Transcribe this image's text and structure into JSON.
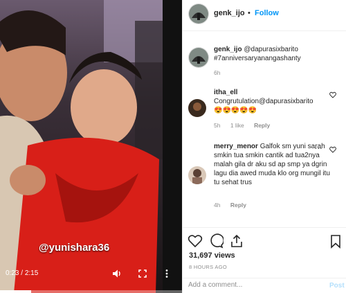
{
  "video": {
    "overlay_text": "@yunishara36",
    "current_time": "0:23",
    "separator": "/",
    "duration": "2:15",
    "progress": 0.17,
    "icons": [
      "volume-icon",
      "fullscreen-icon",
      "more-vertical-icon"
    ]
  },
  "post_header": {
    "username": "genk_ijo",
    "separator": "•",
    "follow_label": "Follow"
  },
  "caption": {
    "username": "genk_ijo",
    "text": "@dapurasixbarito #7anniversaryanangashanty",
    "time": "6h"
  },
  "comments": [
    {
      "username": "itha_ell",
      "text": "Congrutulation@dapurasixbarito",
      "emoji": "😍😍😍😍😍",
      "time": "5h",
      "likes": "1 like",
      "reply_label": "Reply"
    },
    {
      "username": "merry_menor",
      "text": "Galfok sm yuni sarah smkin tua smkin cantik ad tua2nya malah gila dr aku sd ap smp ya dgrin lagu dia awed muda klo org mungil itu tu sehat trus",
      "time": "4h",
      "reply_label": "Reply",
      "more": "..."
    }
  ],
  "stats": {
    "views": "31,697 views",
    "ago": "8 HOURS AGO"
  },
  "add_comment": {
    "placeholder": "Add a comment...",
    "post_label": "Post"
  }
}
